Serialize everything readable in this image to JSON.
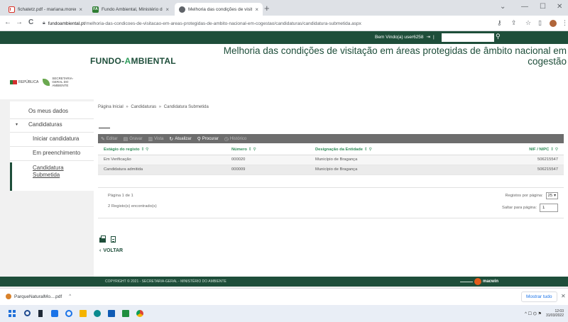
{
  "browser": {
    "tabs": [
      {
        "title": "fichatetz.pdf - mariana.moreno@",
        "close": "×"
      },
      {
        "title": "Fundo Ambiental, Ministério do",
        "close": "×"
      },
      {
        "title": "Melhoria das condições de visita",
        "close": "×"
      }
    ],
    "new_tab": "+",
    "window": {
      "minimize": "—",
      "maximize": "☐",
      "close": "✕",
      "tab_search": "⌄"
    },
    "nav": {
      "back": "←",
      "forward": "→",
      "reload": "C"
    },
    "url_host": "fundoambiental.pt",
    "url_path": "/melhoria-das-condicoes-de-visitacao-em-areas-protegidas-de-ambito-nacional-em-cogestao/candidaturas/candidatura-submetida.aspx"
  },
  "topbar": {
    "welcome": "Bem Vindo(a) user6258",
    "logout_glyph": "⇥",
    "separator": "|",
    "search_placeholder": "",
    "search_glyph": "⚲"
  },
  "header": {
    "logo_prefix": "FUNDO-",
    "logo_accent": "A",
    "logo_suffix": "MBIENTAL",
    "heading": "Melhoria das condições de visitação em áreas protegidas de âmbito nacional em cogestão",
    "rep_logo_text": "REPÚBLICA",
    "sg_logo_text": "SECRETARIA-GERAL DO AMBIENTE"
  },
  "sidebar": {
    "items": [
      {
        "label": "Os meus dados"
      },
      {
        "label": "Candidaturas",
        "marker": "▾"
      },
      {
        "label": "Iniciar candidatura"
      },
      {
        "label": "Em preenchimento"
      },
      {
        "label": "Candidatura Submetida"
      }
    ]
  },
  "breadcrumb": {
    "home": "Página Inicial",
    "section": "Candidaturas",
    "current": "Candidatura Submetida",
    "sep": "»"
  },
  "toolbar": {
    "items": [
      {
        "label": "Editar",
        "icon": "✎"
      },
      {
        "label": "Gravar",
        "icon": "▤"
      },
      {
        "label": "Vista",
        "icon": "▥"
      },
      {
        "label": "Atualizar",
        "icon": "↻"
      },
      {
        "label": "Procurar",
        "icon": "⚲"
      },
      {
        "label": "Histórico",
        "icon": "◷"
      }
    ]
  },
  "table": {
    "sort_mark": "⇕ ⚲",
    "headers": [
      "Estágio do registo",
      "Número",
      "Designação da Entidade",
      "NIF / NIPC"
    ],
    "rows": [
      [
        "Em Verificação",
        "000020",
        "Município de Bragança",
        "506215547"
      ],
      [
        "Candidatura admitida",
        "000009",
        "Município de Bragança",
        "506215547"
      ]
    ]
  },
  "pager": {
    "page_info": "Página 1 de 1",
    "count_info": "2 Registo(s) encontrado(s)",
    "per_page_label": "Registos por página:",
    "per_page_value": "25",
    "per_page_caret": "▾",
    "goto_label": "Saltar para página:",
    "goto_value": "1"
  },
  "voltar": {
    "arrow": "‹",
    "label": "VOLTAR"
  },
  "footer": {
    "copyright": "COPYRIGHT © 2021 - SECRETARIA-GERAL - MINISTÉRIO DO AMBIENTE",
    "vendor": "macwin"
  },
  "downloads": {
    "file": "ParqueNaturalMo....pdf",
    "chevron": "^",
    "show_all": "Mostrar tudo",
    "close": "✕"
  },
  "taskbar": {
    "time": "12:03",
    "date": "31/03/2022",
    "tray_glyphs": "^  ☐  ⌬  ⚑"
  }
}
